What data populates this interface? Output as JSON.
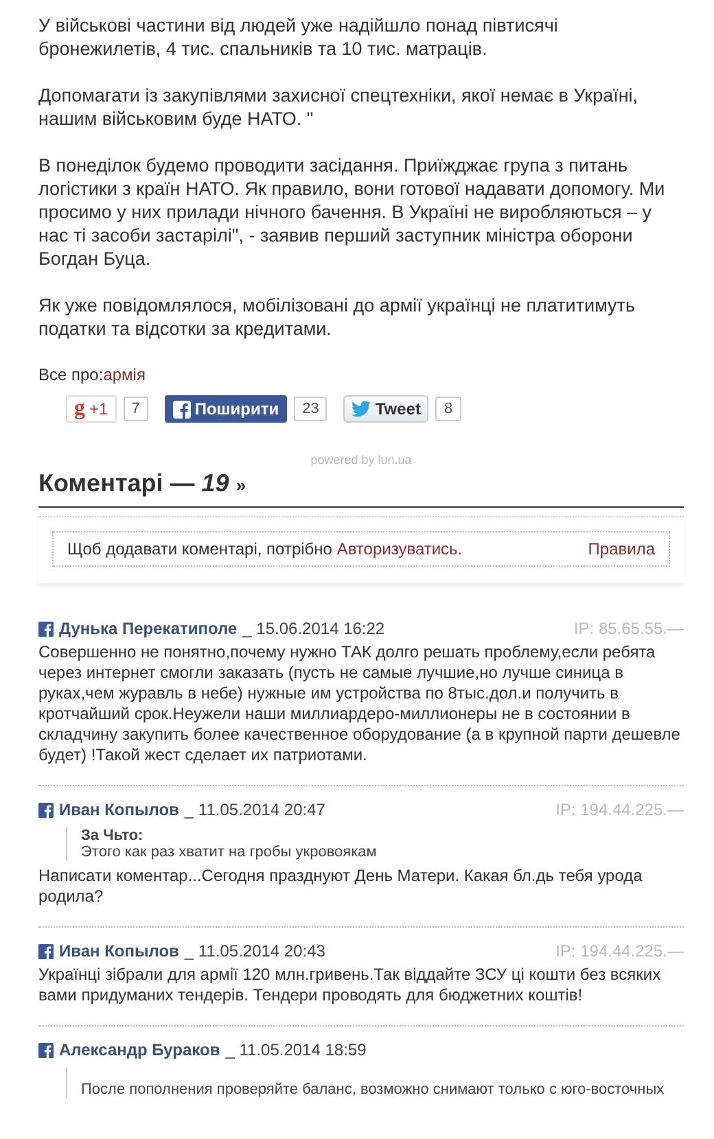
{
  "article": {
    "paragraphs": [
      "У військові частини від людей уже надійшло понад півтисячі бронежилетів, 4 тис. спальників та 10 тис. матраців.",
      "Допомагати із закупівлями захисної спецтехніки, якої немає в Україні, нашим військовим буде НАТО. \"",
      "В понеділок будемо проводити засідання. Приїжджає група з питань логістики з країн НАТО. Як правило, вони готової надавати допомогу. Ми просимо у них прилади нічного бачення. В Україні не виробляються – у нас ті засоби застарілі\", - заявив перший заступник міністра оборони Богдан Буца.",
      "Як уже повідомлялося, мобілізовані до армії українці не платитимуть податки та відсотки за кредитами."
    ]
  },
  "tags": {
    "label": "Все про:",
    "link": "армія"
  },
  "share": [
    {
      "kind": "gplus",
      "logo": "g",
      "label": "+1",
      "count": "7"
    },
    {
      "kind": "facebook",
      "label": "Поширити",
      "count": "23"
    },
    {
      "kind": "twitter",
      "label": "Tweet",
      "count": "8"
    }
  ],
  "powered_by": "powered by lun.ua",
  "comments_header": {
    "title": "Коментарі —",
    "count": "19",
    "arrow": "»"
  },
  "login_notice": {
    "text": "Щоб додавати коментарі, потрібно",
    "link": "Авторизуватись.",
    "rules": "Правила"
  },
  "comments": [
    {
      "author": "Дунька Перекатиполе",
      "date": "_ 15.06.2014 16:22",
      "ip": "IP: 85.65.55.—",
      "text": "Совершенно не понятно,почему нужно ТАК долго решать проблему,если ребята через интернет смогли заказать (пусть не самые лучшие,но лучше синица в руках,чем журавль в небе) нужные им устройства по 8тыс.дол.и получить в кротчайший срок.Неужели наши миллиардеро-миллионеры не в состоянии в складчину закупить более качественное оборудование (а в крупной парти дешевле будет) !Такой жест сделает их патриотами."
    },
    {
      "author": "Иван Копылов",
      "date": "_ 11.05.2014 20:47",
      "ip": "IP: 194.44.225.—",
      "quote": {
        "author": "За Чьто:",
        "text": "Этого как раз хватит на гробы укровоякам"
      },
      "text": "Написати коментар...Сегодня празднуют День Матери. Какая бл.дь тебя урода родила?"
    },
    {
      "author": "Иван Копылов",
      "date": "_ 11.05.2014 20:43",
      "ip": "IP: 194.44.225.—",
      "text": "Українці зібрали для армії 120 млн.гривень.Так віддайте ЗСУ ці кошти без всяких вами придуманих тендерів. Тендери проводять для бюджетних коштів!"
    },
    {
      "author": "Александр Бураков",
      "date": "_ 11.05.2014 18:59",
      "quote": {
        "text": "После пополнения проверяйте баланс, возможно снимают только с юго-восточных"
      }
    }
  ]
}
